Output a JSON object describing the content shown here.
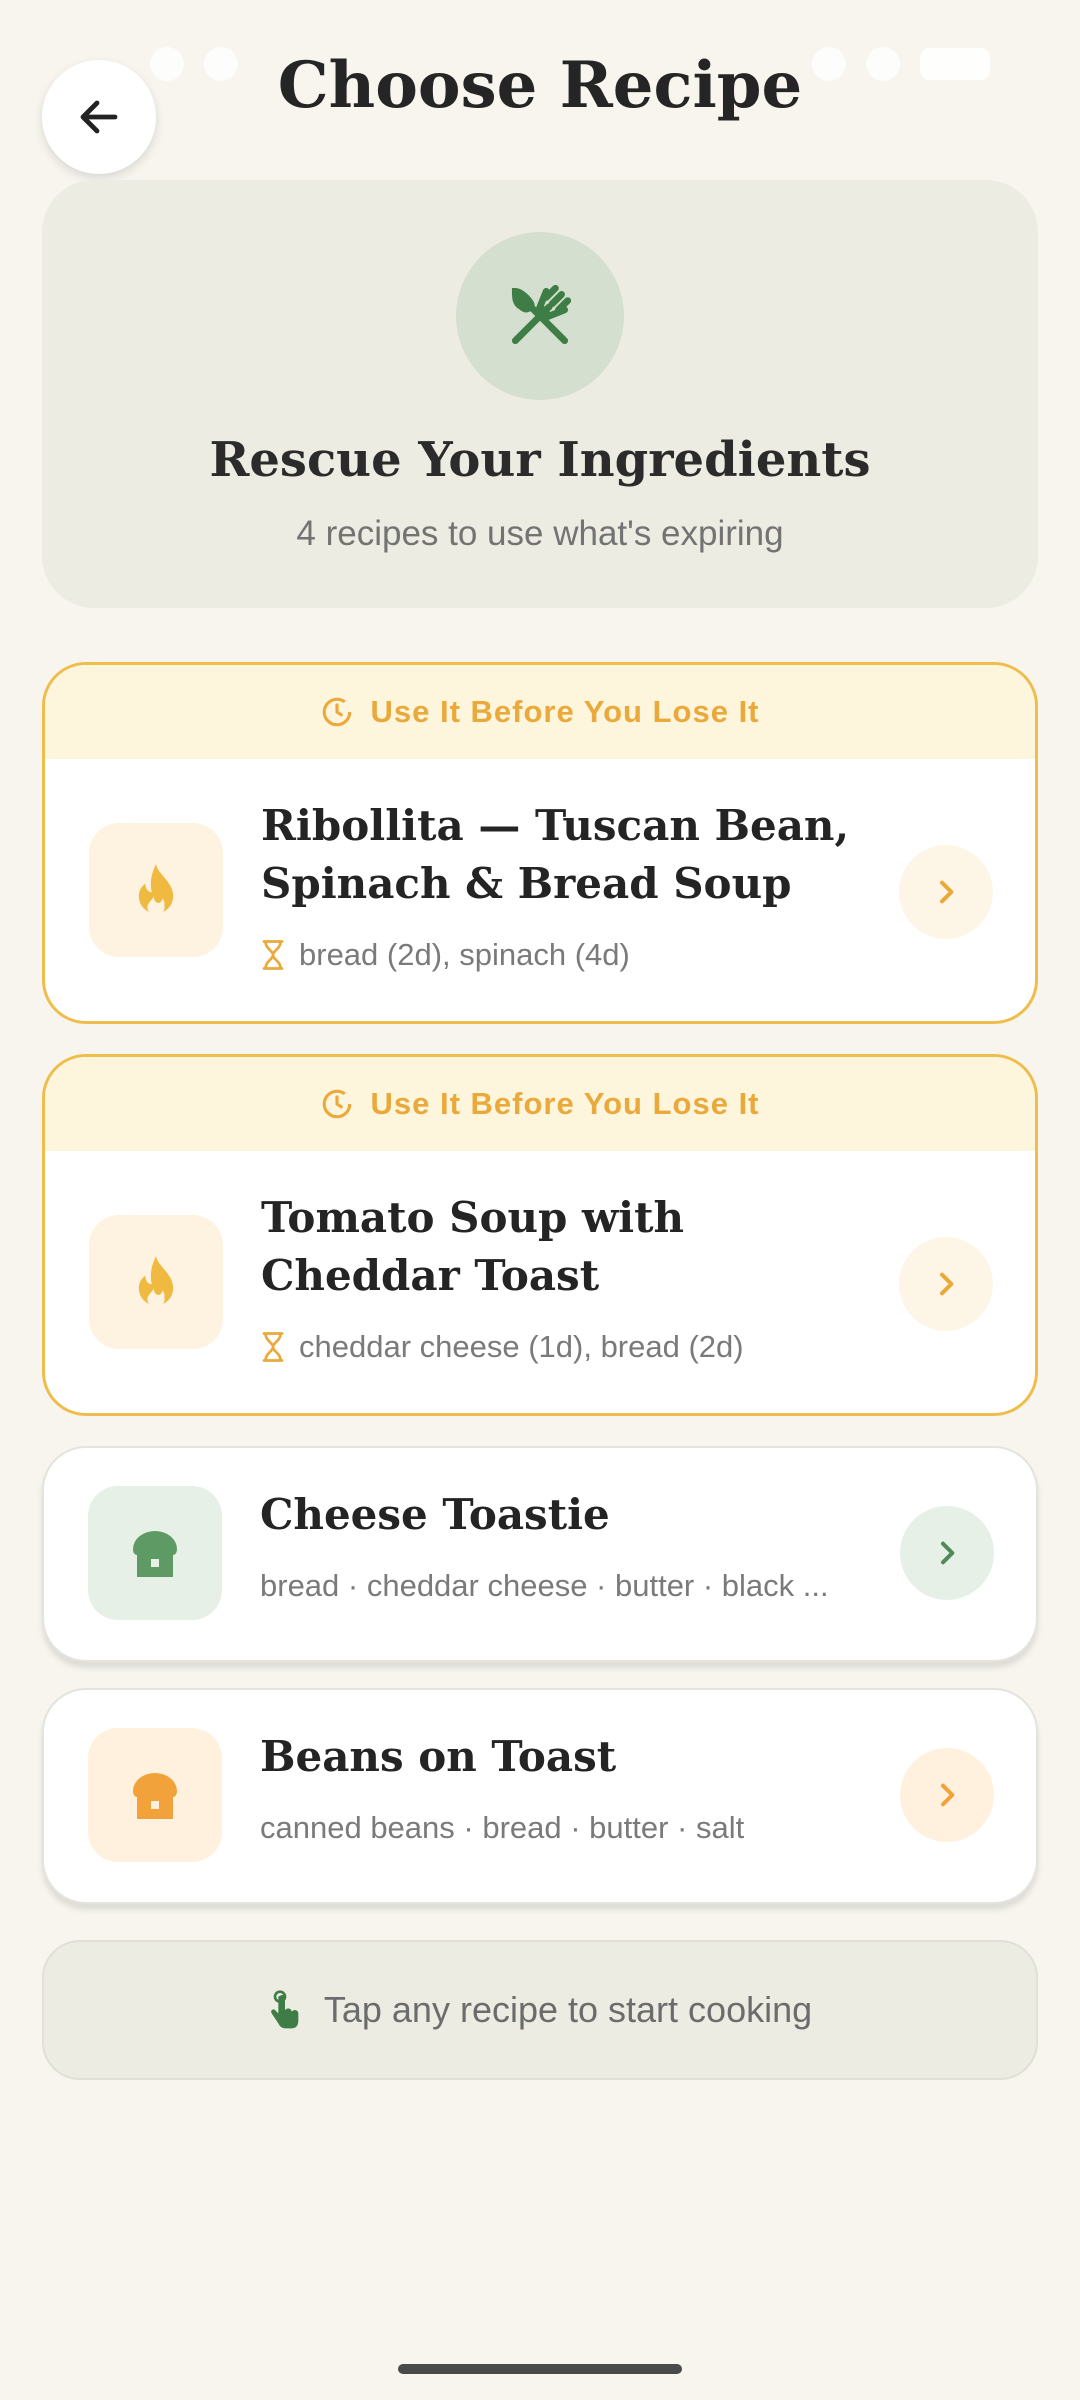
{
  "header": {
    "title": "Choose Recipe"
  },
  "hero": {
    "title": "Rescue Your Ingredients",
    "subtitle": "4 recipes to use what's expiring"
  },
  "recipes": [
    {
      "urgent": true,
      "banner": "Use It Before You Lose It",
      "name": "Ribollita — Tuscan Bean, Spinach & Bread Soup",
      "meta": "bread (2d), spinach (4d)",
      "icon": "flame-icon"
    },
    {
      "urgent": true,
      "banner": "Use It Before You Lose It",
      "name": "Tomato Soup with Cheddar Toast",
      "meta": "cheddar cheese (1d), bread (2d)",
      "icon": "flame-icon"
    },
    {
      "urgent": false,
      "name": "Cheese Toastie",
      "meta": "bread · cheddar cheese · butter · black ...",
      "icon": "bread-icon",
      "accent": "#5e9a64"
    },
    {
      "urgent": false,
      "name": "Beans on Toast",
      "meta": "canned beans · bread · butter · salt",
      "icon": "bread-icon",
      "accent": "#f2a23a"
    }
  ],
  "hint": {
    "text": "Tap any recipe to start cooking"
  },
  "colors": {
    "background": "#f7f5ee",
    "primary_green": "#3f7d46",
    "urgent_amber": "#eebd4c",
    "urgent_text": "#eaa93a"
  }
}
